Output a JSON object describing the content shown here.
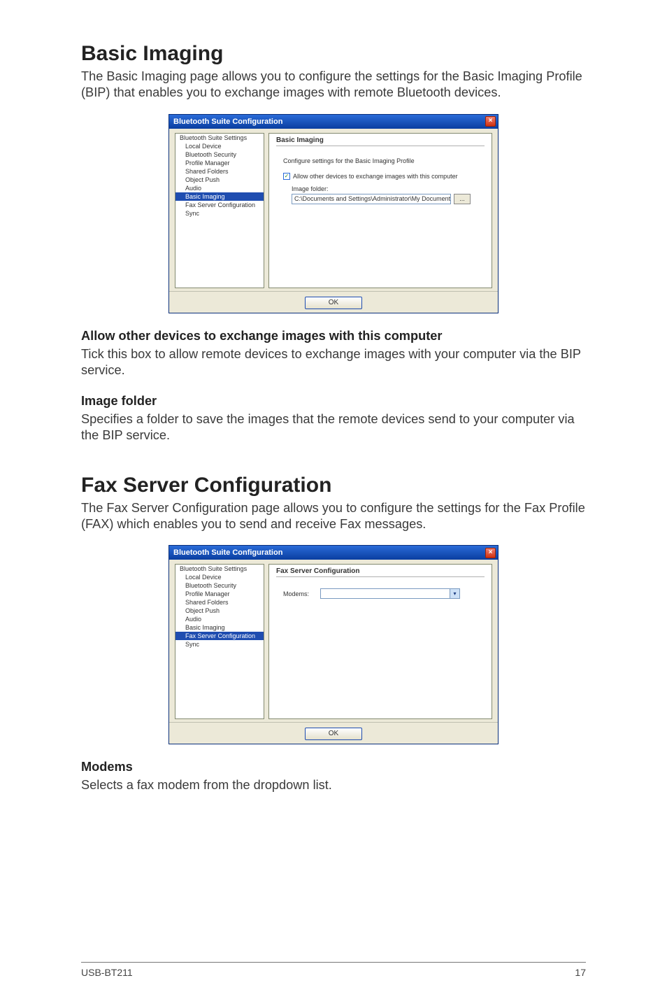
{
  "sec1": {
    "title": "Basic Imaging",
    "intro": "The Basic Imaging page allows you to configure the settings for the Basic Imaging Profile (BIP) that enables you to exchange images with remote Bluetooth devices.",
    "sub1_h": "Allow other devices to exchange images with this computer",
    "sub1_p": "Tick this box to allow remote devices to exchange images with your computer via the BIP service.",
    "sub2_h": "Image folder",
    "sub2_p": "Specifies a folder to save the images that the remote devices send to your computer via the BIP service."
  },
  "sec2": {
    "title": "Fax Server Configuration",
    "intro": "The Fax Server Configuration page allows you to configure the settings for the Fax Profile (FAX) which enables you to send and receive Fax messages.",
    "sub1_h": "Modems",
    "sub1_p": "Selects a fax modem from the dropdown list."
  },
  "dlg_common": {
    "title": "Bluetooth Suite Configuration",
    "close_glyph": "×",
    "ok_label": "OK",
    "check_glyph": "✓",
    "browse_label": "...",
    "drop_glyph": "▾"
  },
  "tree": {
    "items": [
      "Bluetooth Suite Settings",
      "Local Device",
      "Bluetooth Security",
      "Profile Manager",
      "Shared Folders",
      "Object Push",
      "Audio",
      "Basic Imaging",
      "Fax Server Configuration",
      "Sync"
    ]
  },
  "dlg1": {
    "panel_title": "Basic Imaging",
    "line1": "Configure settings for the Basic Imaging Profile",
    "chk_label": "Allow other devices to exchange images with this computer",
    "folder_label": "Image folder:",
    "folder_value": "C:\\Documents and Settings\\Administrator\\My Documents\\"
  },
  "dlg2": {
    "panel_title": "Fax Server Configuration",
    "modems_label": "Modems:"
  },
  "footer": {
    "left": "USB-BT211",
    "right": "17"
  }
}
